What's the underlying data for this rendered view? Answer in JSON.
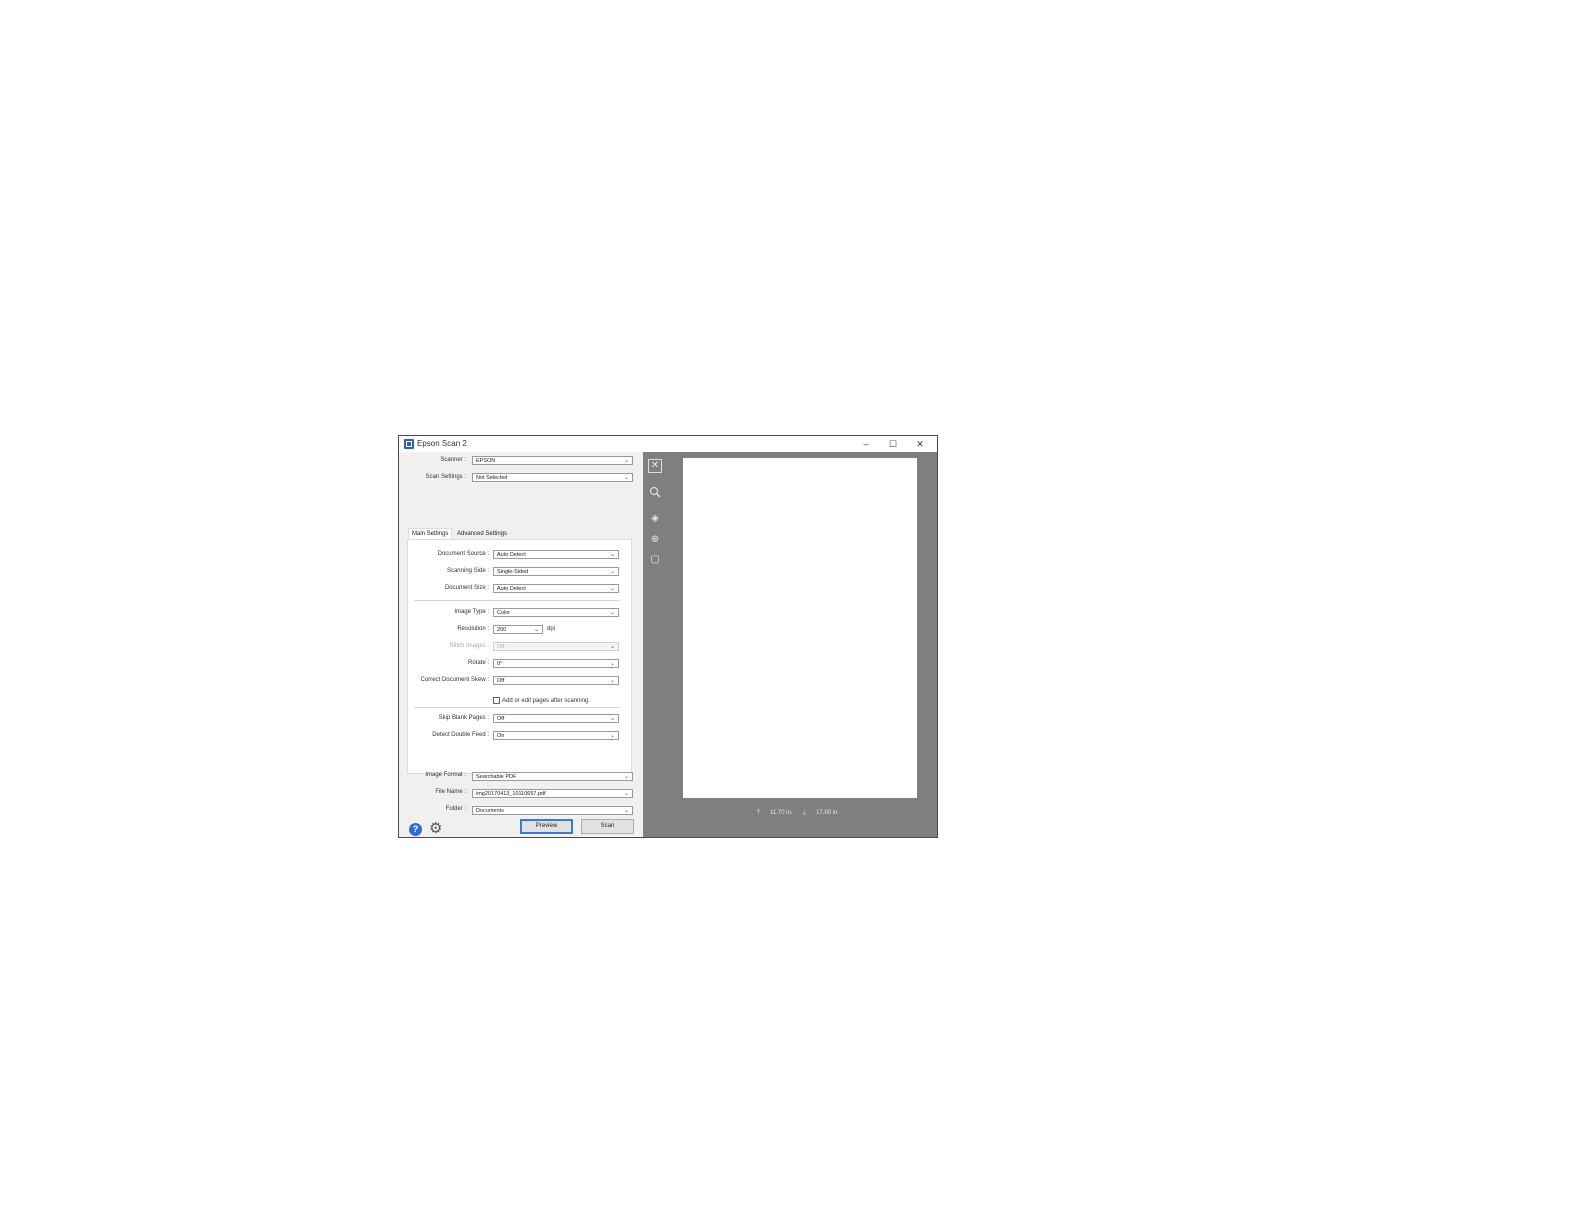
{
  "window": {
    "title": "Epson Scan 2",
    "minimize": "–",
    "maximize": "☐",
    "close": "✕"
  },
  "top": {
    "scanner_label": "Scanner :",
    "scanner_value": "EPSON",
    "scan_settings_label": "Scan Settings :",
    "scan_settings_value": "Not Selected"
  },
  "tabs": [
    "Main Settings",
    "Advanced Settings"
  ],
  "main_settings": {
    "document_source_label": "Document Source :",
    "document_source_value": "Auto Detect",
    "scanning_side_label": "Scanning Side :",
    "scanning_side_value": "Single-Sided",
    "document_size_label": "Document Size :",
    "document_size_value": "Auto Detect",
    "image_type_label": "Image Type :",
    "image_type_value": "Color",
    "resolution_label": "Resolution :",
    "resolution_value": "200",
    "resolution_unit": "dpi",
    "stitch_images_label": "Stitch Images :",
    "stitch_images_value": "Off",
    "rotate_label": "Rotate :",
    "rotate_value": "0°",
    "correct_skew_label": "Correct Document Skew :",
    "correct_skew_value": "Off",
    "add_edit_label": "Add or edit pages after scanning",
    "add_edit_checked": false,
    "skip_blank_label": "Skip Blank Pages :",
    "skip_blank_value": "Off",
    "double_feed_label": "Detect Double Feed :",
    "double_feed_value": "On"
  },
  "output": {
    "image_format_label": "Image Format :",
    "image_format_value": "Searchable PDF",
    "file_name_label": "File Name :",
    "file_name_value": "img20170413_10110657.pdf",
    "folder_label": "Folder :",
    "folder_value": "Documents"
  },
  "buttons": {
    "help_icon": "?",
    "preview": "Preview",
    "scan": "Scan"
  },
  "preview_panel": {
    "width_value": "11.70 in.",
    "height_value": "17.00 in."
  },
  "icons": [
    "help-icon",
    "settings-gear-icon",
    "close-preview-icon",
    "zoom-icon",
    "rotate-icon",
    "add-icon",
    "crop-icon",
    "width-icon",
    "height-icon"
  ],
  "colors": {
    "accent": "#3b7ad9",
    "preview_background": "#7f7f7f",
    "window_background": "#f0f0f0"
  }
}
